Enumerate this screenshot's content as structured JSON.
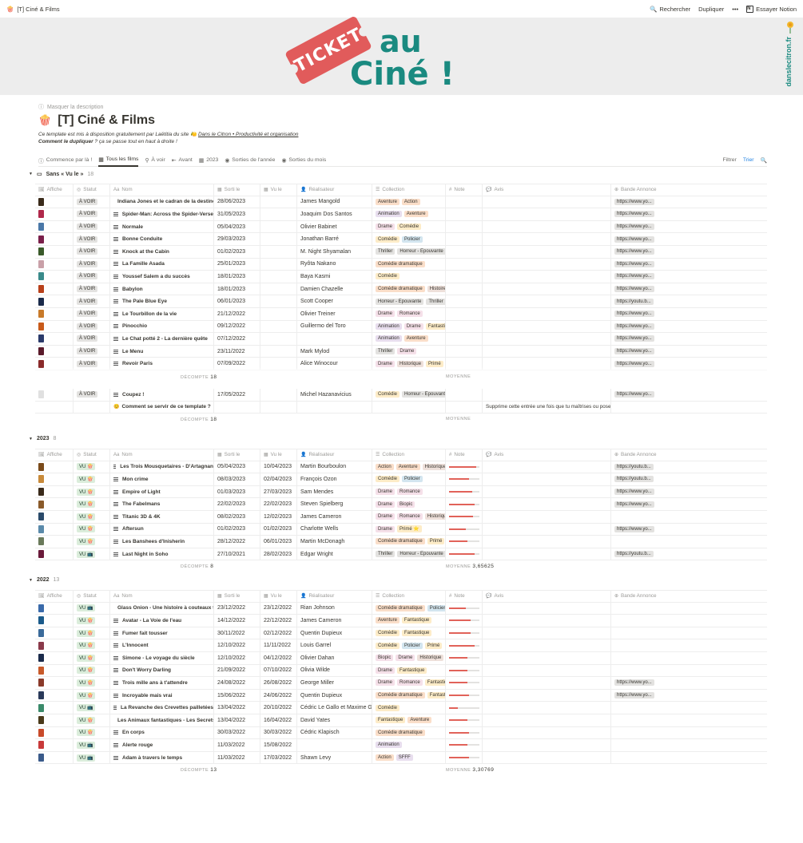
{
  "topbar": {
    "breadcrumb": "[T] Ciné & Films",
    "search": "Rechercher",
    "duplicate": "Dupliquer",
    "more": "•••",
    "try": "Essayer Notion"
  },
  "cover": {
    "ticket": "TICKET",
    "au": "au",
    "cine": "Ciné !",
    "site": "danslecitron.fr"
  },
  "page": {
    "hide_description": "Masquer la description",
    "title": "[T] Ciné & Films",
    "desc_line1_a": "Ce template est mis à disposition gratuitement par Laëtitia du site ",
    "desc_line1_link": "Dans le Citron • Productivité et organisation",
    "desc_line2_bold": "Comment le dupliquer",
    "desc_line2_rest": " ? ça se passe tout en haut à droite !"
  },
  "views": {
    "items": [
      "Commence par là !",
      "Tous les films",
      "À voir",
      "Avant",
      "2023",
      "Sorties de l'année",
      "Sorties du mois"
    ],
    "filter": "Filtrer",
    "sort": "Trier"
  },
  "columns": [
    "Affiche",
    "Statut",
    "Nom",
    "Sorti le",
    "Vu le",
    "Réalisateur",
    "Collection",
    "Note",
    "Avis",
    "Bande Annonce"
  ],
  "groups": [
    {
      "title": "Sans « Vu le »",
      "count": "18",
      "footer_label": "DÉCOMPTE",
      "footer_value": "18",
      "footer_right": "MOYENNE",
      "footer_right_value": "",
      "rows": [
        {
          "statut": "À VOIR",
          "nom": "Indiana Jones et le cadran de la destinée",
          "sorti": "28/06/2023",
          "vu": "",
          "real": "James Mangold",
          "tags": [
            "Aventure",
            "Action"
          ],
          "note": null,
          "avis": "",
          "ba": "https://www.yo...",
          "poster": "#3a2a1a"
        },
        {
          "statut": "À VOIR",
          "nom": "Spider-Man: Across the Spider-Verse",
          "sorti": "31/05/2023",
          "vu": "",
          "real": "Joaquim Dos Santos",
          "tags": [
            "Animation",
            "Aventure"
          ],
          "note": null,
          "avis": "",
          "ba": "https://www.yo...",
          "poster": "#b0284a"
        },
        {
          "statut": "À VOIR",
          "nom": "Normale",
          "sorti": "05/04/2023",
          "vu": "",
          "real": "Olivier Babinet",
          "tags": [
            "Drame",
            "Comédie"
          ],
          "note": null,
          "avis": "",
          "ba": "https://www.yo...",
          "poster": "#4a78a8"
        },
        {
          "statut": "À VOIR",
          "nom": "Bonne Conduite",
          "sorti": "29/03/2023",
          "vu": "",
          "real": "Jonathan Barré",
          "tags": [
            "Comédie",
            "Policier"
          ],
          "note": null,
          "avis": "",
          "ba": "https://www.yo...",
          "poster": "#7a1f4a"
        },
        {
          "statut": "À VOIR",
          "nom": "Knock at the Cabin",
          "sorti": "01/02/2023",
          "vu": "",
          "real": "M. Night Shyamalan",
          "tags": [
            "Thriller",
            "Horreur - Epouvante"
          ],
          "note": null,
          "avis": "",
          "ba": "https://www.yo...",
          "poster": "#3a5a2a"
        },
        {
          "statut": "À VOIR",
          "nom": "La Famille Asada",
          "sorti": "25/01/2023",
          "vu": "",
          "real": "Ryôta Nakano",
          "tags": [
            "Comédie dramatique"
          ],
          "note": null,
          "avis": "",
          "ba": "https://www.yo...",
          "poster": "#c9a0a8"
        },
        {
          "statut": "À VOIR",
          "nom": "Youssef Salem a du succès",
          "sorti": "18/01/2023",
          "vu": "",
          "real": "Baya Kasmi",
          "tags": [
            "Comédie"
          ],
          "note": null,
          "avis": "",
          "ba": "https://www.yo...",
          "poster": "#3a8a8a"
        },
        {
          "statut": "À VOIR",
          "nom": "Babylon",
          "sorti": "18/01/2023",
          "vu": "",
          "real": "Damien Chazelle",
          "tags": [
            "Comédie dramatique",
            "Histoire"
          ],
          "note": null,
          "avis": "",
          "ba": "https://www.yo...",
          "poster": "#b8401a"
        },
        {
          "statut": "À VOIR",
          "nom": "The Pale Blue Eye",
          "sorti": "06/01/2023",
          "vu": "",
          "real": "Scott Cooper",
          "tags": [
            "Horreur - Epouvante",
            "Thriller"
          ],
          "note": null,
          "avis": "",
          "ba": "https://youtu.b...",
          "poster": "#1a2a4a"
        },
        {
          "statut": "À VOIR",
          "nom": "Le Tourbillon de la vie",
          "sorti": "21/12/2022",
          "vu": "",
          "real": "Olivier Treiner",
          "tags": [
            "Drame",
            "Romance"
          ],
          "note": null,
          "avis": "",
          "ba": "https://www.yo...",
          "poster": "#c87a2a"
        },
        {
          "statut": "À VOIR",
          "nom": "Pinocchio",
          "sorti": "09/12/2022",
          "vu": "",
          "real": "Guillermo del Toro",
          "tags": [
            "Animation",
            "Drame",
            "Fantastique"
          ],
          "note": null,
          "avis": "",
          "ba": "https://www.yo...",
          "poster": "#c85a1a"
        },
        {
          "statut": "À VOIR",
          "nom": "Le Chat potté 2 - La dernière quête",
          "sorti": "07/12/2022",
          "vu": "",
          "real": "",
          "tags": [
            "Animation",
            "Aventure"
          ],
          "note": null,
          "avis": "",
          "ba": "https://www.yo...",
          "poster": "#2a3a6a"
        },
        {
          "statut": "À VOIR",
          "nom": "Le Menu",
          "sorti": "23/11/2022",
          "vu": "",
          "real": "Mark Mylod",
          "tags": [
            "Thriller",
            "Drame"
          ],
          "note": null,
          "avis": "",
          "ba": "https://www.yo...",
          "poster": "#5a1a2a"
        },
        {
          "statut": "À VOIR",
          "nom": "Revoir Paris",
          "sorti": "07/09/2022",
          "vu": "",
          "real": "Alice Winocour",
          "tags": [
            "Drame",
            "Historique",
            "Primé"
          ],
          "note": null,
          "avis": "",
          "ba": "https://www.yo...",
          "poster": "#8a2a2a"
        },
        {
          "statut": "À VOIR",
          "nom": "Coupez !",
          "sorti": "17/05/2022",
          "vu": "",
          "real": "Michel Hazanavicius",
          "tags": [
            "Comédie",
            "Horreur - Epouvante"
          ],
          "note": null,
          "avis": "",
          "ba": "https://www.yo...",
          "poster": "#e0e0e0"
        },
        {
          "statut": "",
          "nom": "Comment se servir de ce template ?",
          "sorti": "",
          "vu": "",
          "real": "",
          "tags": [],
          "note": null,
          "avis": "Supprime cette entrée une fois que tu maîtrises ou poses tes questions",
          "ba": "",
          "poster": "",
          "help": true
        }
      ]
    },
    {
      "title": "2023",
      "count": "8",
      "footer_label": "DÉCOMPTE",
      "footer_value": "8",
      "footer_right": "MOYENNE",
      "footer_right_value": "3,65625",
      "rows": [
        {
          "statut": "VU 🍿",
          "nom": "Les Trois Mousquetaires - D'Artagnan",
          "sorti": "05/04/2023",
          "vu": "10/04/2023",
          "real": "Martin Bourboulon",
          "tags": [
            "Action",
            "Aventure",
            "Historique"
          ],
          "note": 0.9,
          "avis": "",
          "ba": "https://youtu.b...",
          "poster": "#7a4a1a"
        },
        {
          "statut": "VU 🍿",
          "nom": "Mon crime",
          "sorti": "08/03/2023",
          "vu": "02/04/2023",
          "real": "François Ozon",
          "tags": [
            "Comédie",
            "Policier"
          ],
          "note": 0.65,
          "avis": "",
          "ba": "https://youtu.b...",
          "poster": "#c88a3a"
        },
        {
          "statut": "VU 🍿",
          "nom": "Empire of Light",
          "sorti": "01/03/2023",
          "vu": "27/03/2023",
          "real": "Sam Mendes",
          "tags": [
            "Drame",
            "Romance"
          ],
          "note": 0.75,
          "avis": "",
          "ba": "https://www.yo...",
          "poster": "#3a2a1a"
        },
        {
          "statut": "VU 🍿",
          "nom": "The Fabelmans",
          "sorti": "22/02/2023",
          "vu": "22/02/2023",
          "real": "Steven Spielberg",
          "tags": [
            "Drame",
            "Biopic"
          ],
          "note": 0.85,
          "avis": "",
          "ba": "https://www.yo...",
          "poster": "#8a5a2a"
        },
        {
          "statut": "VU 🍿",
          "nom": "Titanic 3D & 4K",
          "sorti": "08/02/2023",
          "vu": "12/02/2023",
          "real": "James Cameron",
          "tags": [
            "Drame",
            "Romance",
            "Historique"
          ],
          "note": 0.8,
          "avis": "",
          "ba": "",
          "poster": "#2a4a6a"
        },
        {
          "statut": "VU 🍿",
          "nom": "Aftersun",
          "sorti": "01/02/2023",
          "vu": "01/02/2023",
          "real": "Charlotte Wells",
          "tags": [
            "Drame",
            "Primé ⭐"
          ],
          "note": 0.55,
          "avis": "",
          "ba": "https://www.yo...",
          "poster": "#5a8aaa"
        },
        {
          "statut": "VU 🍿",
          "nom": "Les Banshees d'Inisherin",
          "sorti": "28/12/2022",
          "vu": "06/01/2023",
          "real": "Martin McDonagh",
          "tags": [
            "Comédie dramatique",
            "Primé"
          ],
          "note": 0.6,
          "avis": "",
          "ba": "",
          "poster": "#6a7a5a"
        },
        {
          "statut": "VU 📺",
          "nom": "Last Night in Soho",
          "sorti": "27/10/2021",
          "vu": "28/02/2023",
          "real": "Edgar Wright",
          "tags": [
            "Thriller",
            "Horreur - Epouvante"
          ],
          "note": 0.85,
          "avis": "",
          "ba": "https://youtu.b...",
          "poster": "#6a1a3a"
        }
      ]
    },
    {
      "title": "2022",
      "count": "13",
      "footer_label": "DÉCOMPTE",
      "footer_value": "13",
      "footer_right": "MOYENNE",
      "footer_right_value": "3,30769",
      "rows": [
        {
          "statut": "VU 📺",
          "nom": "Glass Onion - Une histoire à couteaux tirés",
          "sorti": "23/12/2022",
          "vu": "23/12/2022",
          "real": "Rian Johnson",
          "tags": [
            "Comédie dramatique",
            "Policier"
          ],
          "note": 0.55,
          "avis": "",
          "ba": "",
          "poster": "#3a6aaa"
        },
        {
          "statut": "VU 🍿",
          "nom": "Avatar - La Voie de l'eau",
          "sorti": "14/12/2022",
          "vu": "22/12/2022",
          "real": "James Cameron",
          "tags": [
            "Aventure",
            "Fantastique"
          ],
          "note": 0.7,
          "avis": "",
          "ba": "",
          "poster": "#1a5a8a"
        },
        {
          "statut": "VU 🍿",
          "nom": "Fumer fait tousser",
          "sorti": "30/11/2022",
          "vu": "02/12/2022",
          "real": "Quentin Dupieux",
          "tags": [
            "Comédie",
            "Fantastique"
          ],
          "note": 0.7,
          "avis": "",
          "ba": "",
          "poster": "#3a6a9a"
        },
        {
          "statut": "VU 🍿",
          "nom": "L'Innocent",
          "sorti": "12/10/2022",
          "vu": "11/11/2022",
          "real": "Louis Garrel",
          "tags": [
            "Comédie",
            "Policier",
            "Primé"
          ],
          "note": 0.85,
          "avis": "",
          "ba": "",
          "poster": "#8a3a4a"
        },
        {
          "statut": "VU 🍿",
          "nom": "Simone - Le voyage du siècle",
          "sorti": "12/10/2022",
          "vu": "04/12/2022",
          "real": "Olivier Dahan",
          "tags": [
            "Biopic",
            "Drame",
            "Historique"
          ],
          "note": 0.6,
          "avis": "",
          "ba": "",
          "poster": "#1a2a4a"
        },
        {
          "statut": "VU 🍿",
          "nom": "Don't Worry Darling",
          "sorti": "21/09/2022",
          "vu": "07/10/2022",
          "real": "Olivia Wilde",
          "tags": [
            "Drame",
            "Fantastique"
          ],
          "note": 0.6,
          "avis": "",
          "ba": "",
          "poster": "#c85a2a"
        },
        {
          "statut": "VU 🍿",
          "nom": "Trois mille ans à t'attendre",
          "sorti": "24/08/2022",
          "vu": "26/08/2022",
          "real": "George Miller",
          "tags": [
            "Drame",
            "Romance",
            "Fantastique"
          ],
          "note": 0.6,
          "avis": "",
          "ba": "https://www.yo...",
          "poster": "#8a3a2a"
        },
        {
          "statut": "VU 🍿",
          "nom": "Incroyable mais vrai",
          "sorti": "15/06/2022",
          "vu": "24/06/2022",
          "real": "Quentin Dupieux",
          "tags": [
            "Comédie dramatique",
            "Fantastique"
          ],
          "note": 0.65,
          "avis": "",
          "ba": "https://www.yo...",
          "poster": "#2a3a5a"
        },
        {
          "statut": "VU 📺",
          "nom": "La Revanche des Crevettes pailletées",
          "sorti": "13/04/2022",
          "vu": "20/10/2022",
          "real": "Cédric Le Gallo et Maxime Govare",
          "tags": [
            "Comédie"
          ],
          "note": 0.3,
          "avis": "",
          "ba": "",
          "poster": "#3a8a6a"
        },
        {
          "statut": "VU 🍿",
          "nom": "Les Animaux fantastiques - Les Secrets de Dumbledore",
          "sorti": "13/04/2022",
          "vu": "16/04/2022",
          "real": "David Yates",
          "tags": [
            "Fantastique",
            "Aventure"
          ],
          "note": 0.6,
          "avis": "",
          "ba": "",
          "poster": "#4a3a1a"
        },
        {
          "statut": "VU 🍿",
          "nom": "En corps",
          "sorti": "30/03/2022",
          "vu": "30/03/2022",
          "real": "Cédric Klapisch",
          "tags": [
            "Comédie dramatique"
          ],
          "note": 0.65,
          "avis": "",
          "ba": "",
          "poster": "#c84a2a"
        },
        {
          "statut": "VU 📺",
          "nom": "Alerte rouge",
          "sorti": "11/03/2022",
          "vu": "15/08/2022",
          "real": "",
          "tags": [
            "Animation"
          ],
          "note": 0.6,
          "avis": "",
          "ba": "",
          "poster": "#c83a3a"
        },
        {
          "statut": "VU 📺",
          "nom": "Adam à travers le temps",
          "sorti": "11/03/2022",
          "vu": "17/03/2022",
          "real": "Shawn Levy",
          "tags": [
            "Action",
            "SFFF"
          ],
          "note": 0.65,
          "avis": "",
          "ba": "",
          "poster": "#3a5a8a"
        }
      ]
    }
  ]
}
